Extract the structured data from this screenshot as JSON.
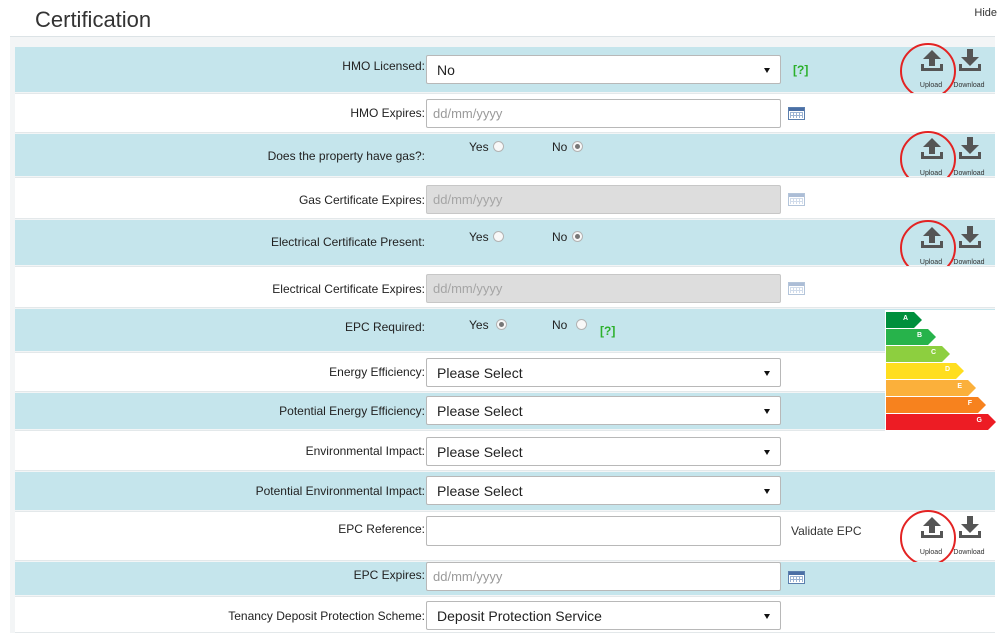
{
  "header": {
    "title": "Certification",
    "hide_label": "Hide"
  },
  "fields": {
    "hmo_licensed": {
      "label": "HMO Licensed:",
      "value": "No",
      "help": "[?]"
    },
    "hmo_expires": {
      "label": "HMO Expires:",
      "placeholder": "dd/mm/yyyy"
    },
    "has_gas": {
      "label": "Does the property have gas?:",
      "yes": "Yes",
      "no": "No",
      "selected": "No"
    },
    "gas_cert_expires": {
      "label": "Gas Certificate Expires:",
      "placeholder": "dd/mm/yyyy"
    },
    "electrical_present": {
      "label": "Electrical Certificate Present:",
      "yes": "Yes",
      "no": "No",
      "selected": "No"
    },
    "electrical_expires": {
      "label": "Electrical Certificate Expires:",
      "placeholder": "dd/mm/yyyy"
    },
    "epc_required": {
      "label": "EPC Required:",
      "yes": "Yes",
      "no": "No",
      "selected": "Yes",
      "help": "[?]"
    },
    "energy_efficiency": {
      "label": "Energy Efficiency:",
      "value": "Please Select"
    },
    "potential_energy_efficiency": {
      "label": "Potential Energy Efficiency:",
      "value": "Please Select"
    },
    "environmental_impact": {
      "label": "Environmental Impact:",
      "value": "Please Select"
    },
    "potential_environmental_impact": {
      "label": "Potential Environmental Impact:",
      "value": "Please Select"
    },
    "epc_reference": {
      "label": "EPC Reference:",
      "value": "",
      "validate_label": "Validate EPC"
    },
    "epc_expires": {
      "label": "EPC Expires:",
      "placeholder": "dd/mm/yyyy"
    },
    "deposit_scheme": {
      "label": "Tenancy Deposit Protection Scheme:",
      "value": "Deposit Protection Service"
    }
  },
  "file_buttons": {
    "upload_label": "Upload",
    "download_label": "Download"
  },
  "epc_bands": [
    {
      "letter": "A",
      "color": "#008f3c"
    },
    {
      "letter": "B",
      "color": "#27b34b"
    },
    {
      "letter": "C",
      "color": "#8dcf3f"
    },
    {
      "letter": "D",
      "color": "#ffde1f"
    },
    {
      "letter": "E",
      "color": "#fbb03b"
    },
    {
      "letter": "F",
      "color": "#f7821e"
    },
    {
      "letter": "G",
      "color": "#ed1c24"
    }
  ]
}
